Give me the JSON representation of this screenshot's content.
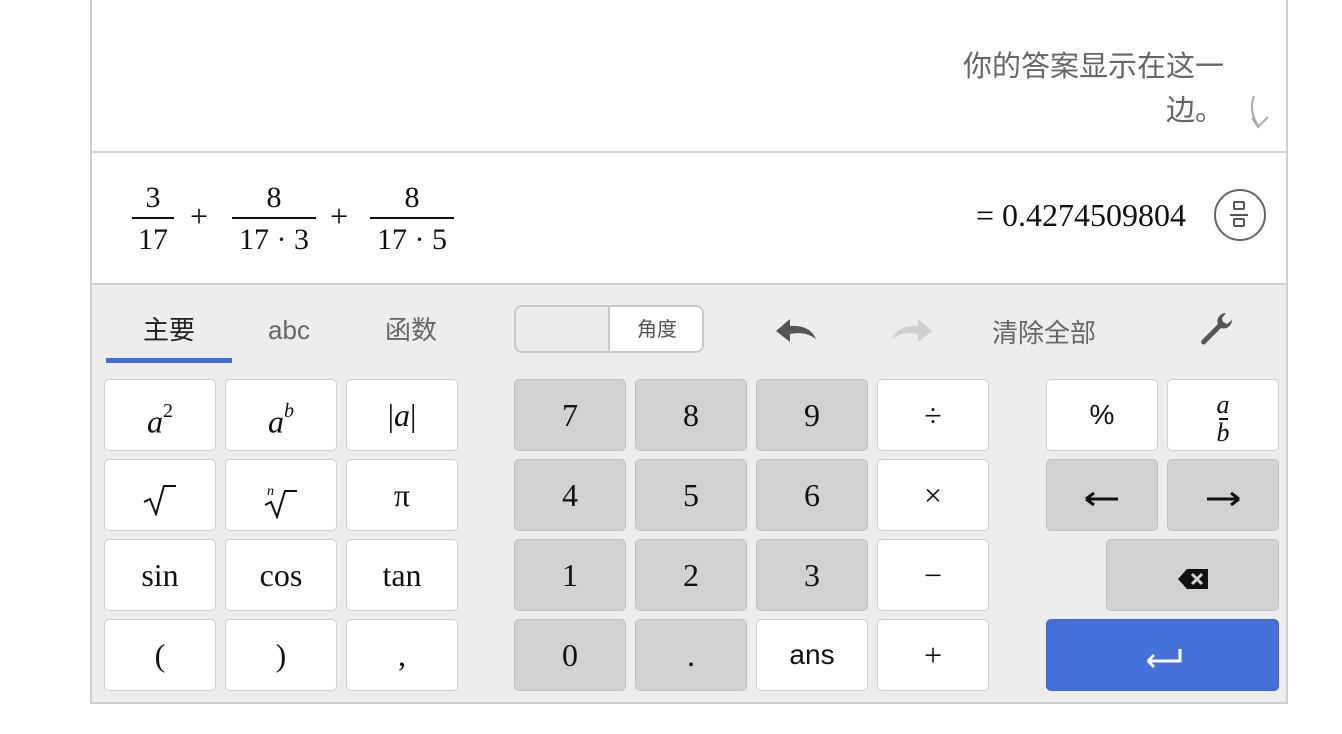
{
  "hint": {
    "text": "你的答案显示在这一边。"
  },
  "expression": {
    "fractions": [
      {
        "numerator": "3",
        "denominator": "17"
      },
      {
        "numerator": "8",
        "denominator": "17 · 3"
      },
      {
        "numerator": "8",
        "denominator": "17 · 5"
      }
    ],
    "operators": [
      "+",
      "+"
    ],
    "result": "= 0.4274509804"
  },
  "keypad": {
    "tabs": [
      {
        "label": "主要",
        "active": true
      },
      {
        "label": "abc",
        "active": false
      },
      {
        "label": "函数",
        "active": false
      }
    ],
    "angle_toggle_label": "角度",
    "clear_all_label": "清除全部",
    "accent_color": "#3d6fd6",
    "enter_color": "#4471d8",
    "left_keys": {
      "row1": [
        "a²",
        "aᵇ",
        "|a|"
      ],
      "row2": [
        "√",
        "ⁿ√",
        "π"
      ],
      "row3": [
        "sin",
        "cos",
        "tan"
      ],
      "row4": [
        "(",
        ")",
        ","
      ]
    },
    "num_keys": {
      "row1": [
        "7",
        "8",
        "9",
        "÷"
      ],
      "row2": [
        "4",
        "5",
        "6",
        "×"
      ],
      "row3": [
        "1",
        "2",
        "3",
        "−"
      ],
      "row4": [
        "0",
        ".",
        "ans",
        "+"
      ]
    },
    "right_keys": {
      "percent": "%",
      "fraction_num": "a",
      "fraction_den": "b",
      "left_arrow": "⟵",
      "right_arrow": "⟶",
      "backspace_icon": "backspace-icon",
      "enter_icon": "enter-icon"
    }
  }
}
